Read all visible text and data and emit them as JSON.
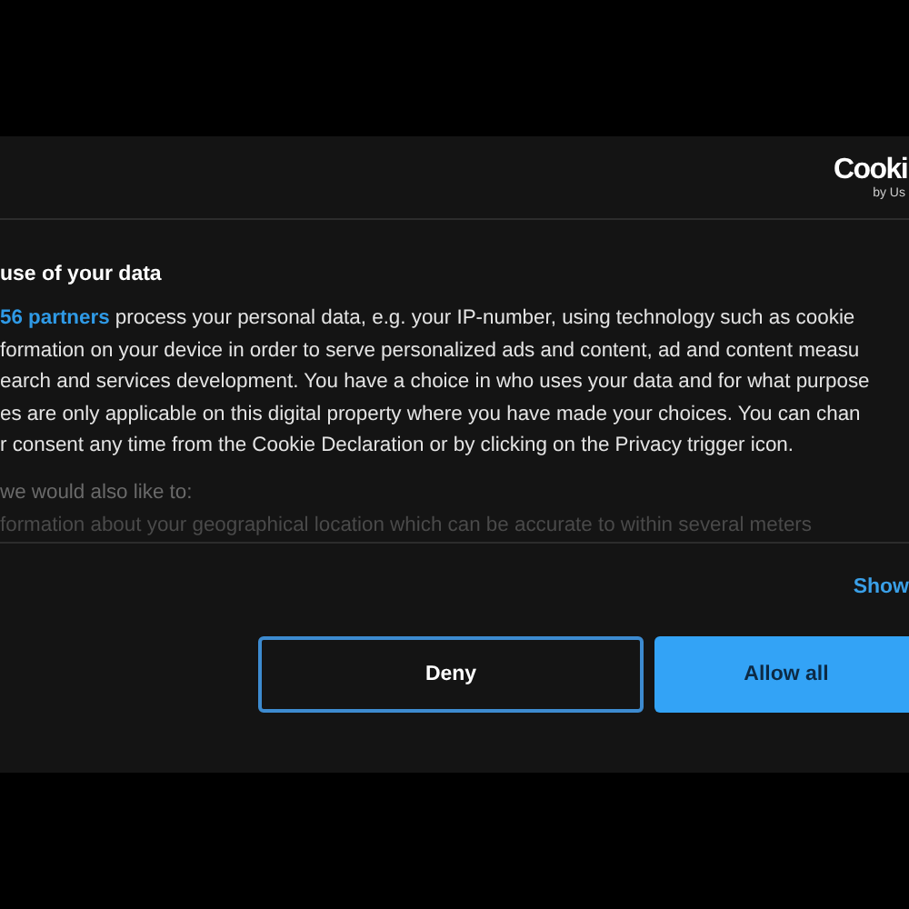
{
  "logo": {
    "wordmark": "Cooki",
    "tagline": "by Us"
  },
  "heading": "use of your data",
  "intro": {
    "link": "56 partners",
    "rest": " process your personal data, e.g. your IP-number, using technology such as cookie"
  },
  "paragraph_lines": [
    "formation on your device in order to serve personalized ads and content, ad and content measu",
    "earch and services development. You have a choice in who uses your data and for what purpose",
    "es are only applicable on this digital property where you have made your choices. You can chan",
    "r consent any time from the Cookie Declaration or by clicking on the Privacy trigger icon."
  ],
  "faded_lines": [
    "we would also like to:",
    "formation about your geographical location which can be accurate to within several meters"
  ],
  "details_link": "Show",
  "buttons": [
    {
      "label": "Deny",
      "kind": "outline"
    },
    {
      "label": "Allow all",
      "kind": "filled"
    }
  ]
}
